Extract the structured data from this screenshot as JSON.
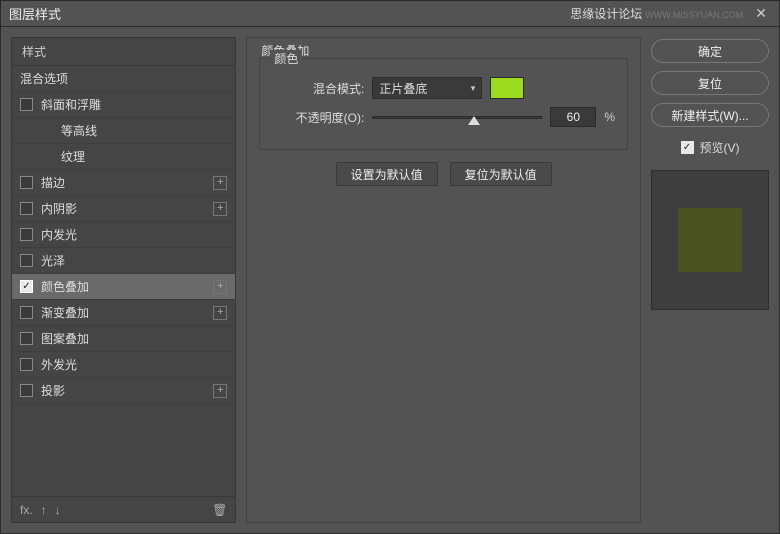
{
  "title": "图层样式",
  "watermark": {
    "text": "思缘设计论坛",
    "url": "WWW.MISSYUAN.COM"
  },
  "left": {
    "header": "样式",
    "blendOptions": "混合选项",
    "items": [
      {
        "label": "斜面和浮雕",
        "checked": false,
        "plus": false
      },
      {
        "label": "等高线",
        "checked": false,
        "plus": false,
        "sub": true
      },
      {
        "label": "纹理",
        "checked": false,
        "plus": false,
        "sub": true
      },
      {
        "label": "描边",
        "checked": false,
        "plus": true
      },
      {
        "label": "内阴影",
        "checked": false,
        "plus": true
      },
      {
        "label": "内发光",
        "checked": false,
        "plus": false
      },
      {
        "label": "光泽",
        "checked": false,
        "plus": false
      },
      {
        "label": "颜色叠加",
        "checked": true,
        "plus": true,
        "selected": true
      },
      {
        "label": "渐变叠加",
        "checked": false,
        "plus": true
      },
      {
        "label": "图案叠加",
        "checked": false,
        "plus": false
      },
      {
        "label": "外发光",
        "checked": false,
        "plus": false
      },
      {
        "label": "投影",
        "checked": false,
        "plus": true
      }
    ],
    "foot": {
      "fx": "fx."
    }
  },
  "mid": {
    "title": "颜色叠加",
    "group": "颜色",
    "blendMode": {
      "label": "混合模式:",
      "value": "正片叠底"
    },
    "opacity": {
      "label": "不透明度(O):",
      "value": "60",
      "suffix": "%",
      "pct": 60
    },
    "swatch": "#9cdb1f",
    "setDefault": "设置为默认值",
    "resetDefault": "复位为默认值"
  },
  "right": {
    "ok": "确定",
    "cancel": "复位",
    "newStyle": "新建样式(W)...",
    "preview": "预览(V)"
  }
}
